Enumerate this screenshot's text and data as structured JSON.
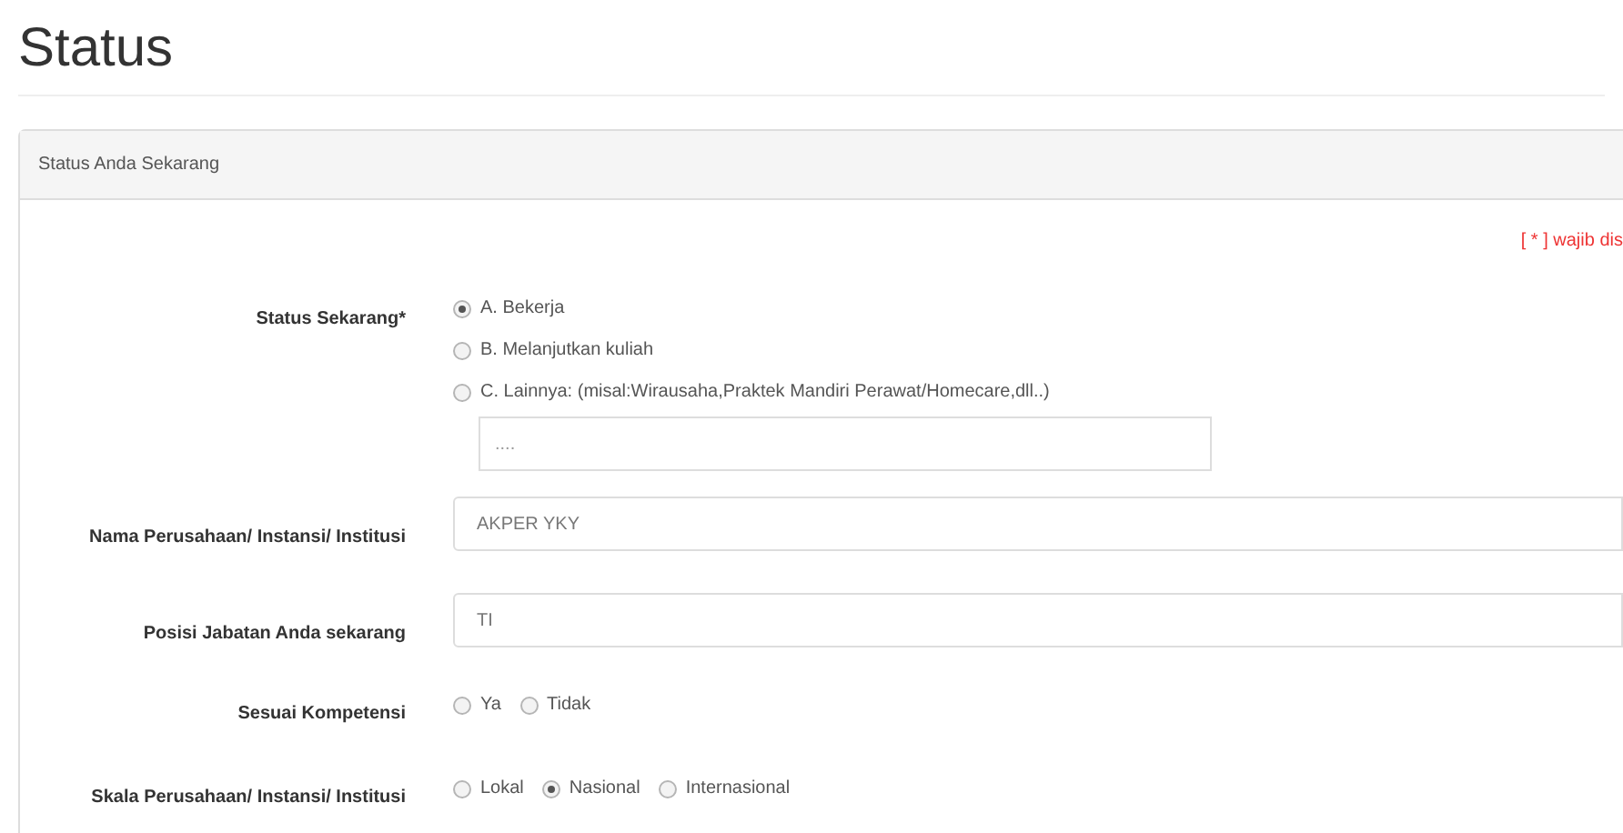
{
  "page_title": "Status",
  "panel": {
    "title": "Status Anda Sekarang",
    "required_note": "[ * ] wajib dis",
    "fields": [
      {
        "kind": "radio",
        "label": "Status Sekarang*",
        "options": [
          {
            "label": "A. Bekerja",
            "selected": true
          },
          {
            "label": "B. Melanjutkan kuliah",
            "selected": false
          },
          {
            "label": "C. Lainnya: (misal:Wirausaha,Praktek Mandiri Perawat/Homecare,dll..)",
            "selected": false
          }
        ],
        "other": {
          "placeholder": "...."
        }
      },
      {
        "kind": "text",
        "label": "Nama Perusahaan/ Instansi/ Institusi",
        "placeholder": "AKPER YKY"
      },
      {
        "kind": "text",
        "label": "Posisi Jabatan Anda sekarang",
        "placeholder": "TI"
      },
      {
        "kind": "inline",
        "label": "Sesuai Kompetensi",
        "options": [
          {
            "label": "Ya",
            "selected": false
          },
          {
            "label": "Tidak",
            "selected": false
          }
        ]
      },
      {
        "kind": "inline",
        "label": "Skala Perusahaan/ Instansi/ Institusi",
        "options": [
          {
            "label": "Lokal",
            "selected": false
          },
          {
            "label": "Nasional",
            "selected": true
          },
          {
            "label": "Internasional",
            "selected": false
          }
        ]
      }
    ]
  }
}
